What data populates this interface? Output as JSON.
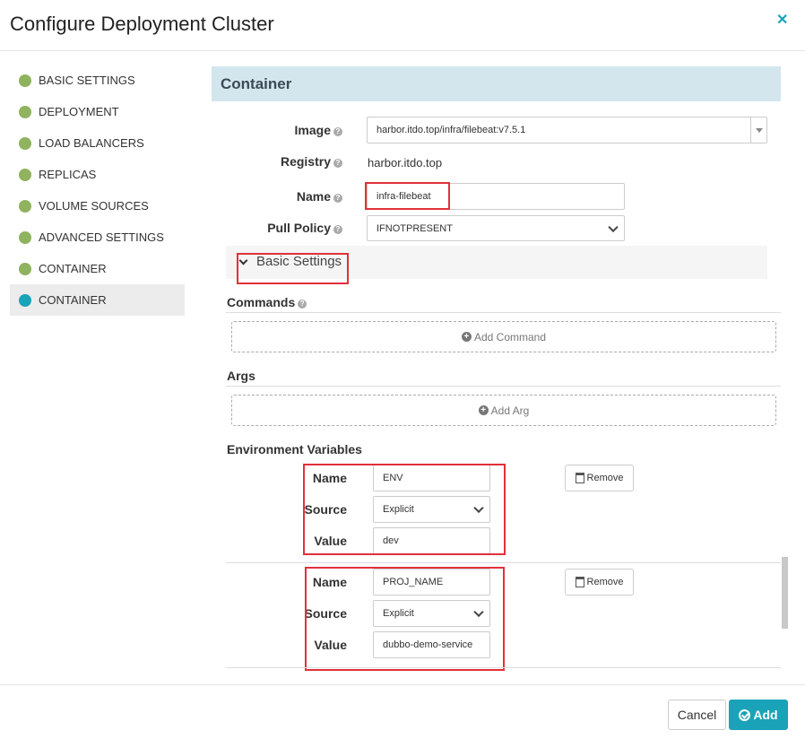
{
  "modal": {
    "title": "Configure Deployment Cluster",
    "close_icon": "close-icon"
  },
  "sidebar": {
    "items": [
      {
        "label": "BASIC SETTINGS",
        "status": "complete"
      },
      {
        "label": "DEPLOYMENT",
        "status": "complete"
      },
      {
        "label": "LOAD BALANCERS",
        "status": "complete"
      },
      {
        "label": "REPLICAS",
        "status": "complete"
      },
      {
        "label": "VOLUME SOURCES",
        "status": "complete"
      },
      {
        "label": "ADVANCED SETTINGS",
        "status": "complete"
      },
      {
        "label": "CONTAINER",
        "status": "complete"
      },
      {
        "label": "CONTAINER",
        "status": "active"
      }
    ]
  },
  "container": {
    "heading": "Container",
    "image": {
      "label": "Image",
      "value": "harbor.itdo.top/infra/filebeat:v7.5.1"
    },
    "registry": {
      "label": "Registry",
      "value": "harbor.itdo.top"
    },
    "name": {
      "label": "Name",
      "value": "infra-filebeat"
    },
    "pull_policy": {
      "label": "Pull Policy",
      "value": "IFNOTPRESENT"
    },
    "basic_settings": {
      "label": "Basic Settings"
    },
    "commands": {
      "label": "Commands",
      "add_label": "Add Command"
    },
    "args": {
      "label": "Args",
      "add_label": "Add Arg"
    },
    "env": {
      "label": "Environment Variables",
      "field_labels": {
        "name": "Name",
        "source": "Source",
        "value": "Value"
      },
      "remove_label": "Remove",
      "items": [
        {
          "name": "ENV",
          "source": "Explicit",
          "value": "dev"
        },
        {
          "name": "PROJ_NAME",
          "source": "Explicit",
          "value": "dubbo-demo-service"
        }
      ]
    }
  },
  "footer": {
    "cancel_label": "Cancel",
    "add_label": "Add"
  },
  "colors": {
    "accent": "#1aa3b8",
    "complete_dot": "#8fb35e",
    "section_bg": "#d3e6ee",
    "highlight": "#e0313a"
  }
}
